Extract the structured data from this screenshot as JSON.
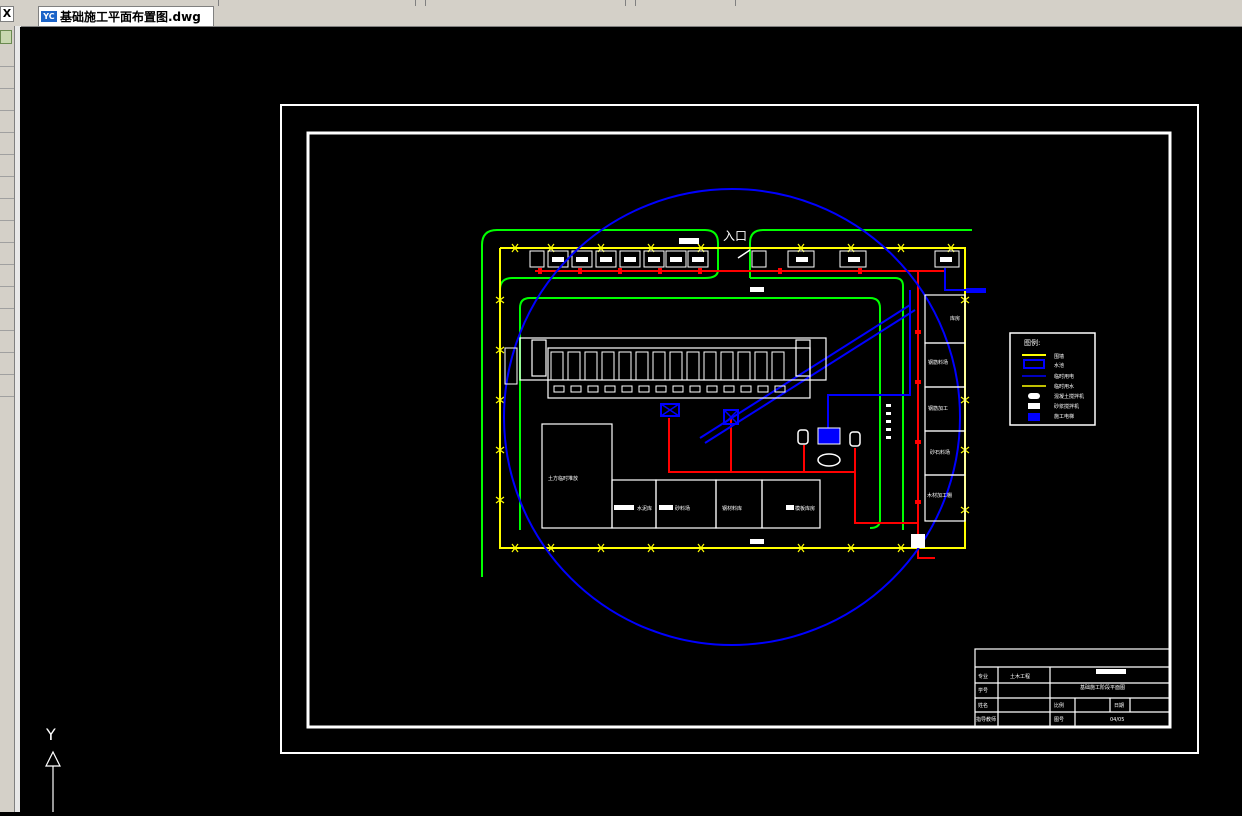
{
  "window": {
    "close_glyph": "X",
    "tab_icon_text": "YC",
    "tab_title": "基础施工平面布置图.dwg"
  },
  "drawing": {
    "entrance_label": "入口",
    "buildings": {
      "earthwork": "土方临时堆放",
      "steel_shop": "钢筋加工",
      "rebar_store": "钢材料库",
      "sand_stone": "砂料场",
      "formwork": "模板库房",
      "cement": "水泥库",
      "steel_yard": "钢筋料场",
      "sand": "砂石料场",
      "carpentry": "木材加工棚",
      "site_office": "库房"
    },
    "legend": {
      "title": "图例:",
      "items": [
        "围墙",
        "水池",
        "临时用电",
        "临时用水",
        "混凝土搅拌机",
        "砂浆搅拌机",
        "施工电梯"
      ]
    },
    "title_block": {
      "major_label": "专业",
      "major_value": "土木工程",
      "student_id_label": "学号",
      "name_label": "姓名",
      "advisor_label": "指导教师",
      "drawing_title": "基础施工阶段平面图",
      "scale_label": "比例",
      "date_label": "日期",
      "sheet_label": "图号",
      "sheet_value": "04/05"
    },
    "ucs_axis_label": "Y"
  },
  "colors": {
    "frame": "#ffffff",
    "fence": "#ffff00",
    "road": "#00ff00",
    "power": "#ff0000",
    "water": "#0000ff",
    "crane": "#0000ff"
  }
}
